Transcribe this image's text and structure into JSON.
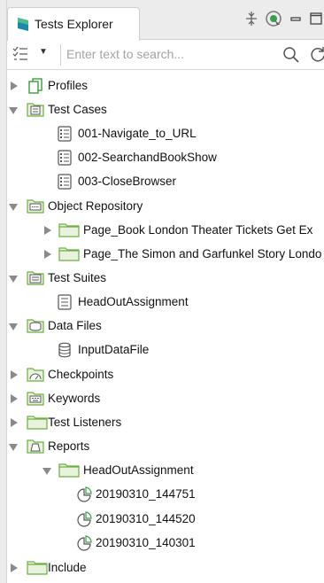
{
  "tab": {
    "title": "Tests Explorer"
  },
  "toolbar": {
    "icons": [
      "collapse-all-icon",
      "focus-icon",
      "minimize-icon",
      "maximize-icon"
    ]
  },
  "search": {
    "placeholder": "Enter text to search...",
    "value": ""
  },
  "tree": {
    "profiles": "Profiles",
    "test_cases": "Test Cases",
    "tc_1": "001-Navigate_to_URL",
    "tc_2": "002-SearchandBookShow",
    "tc_3": "003-CloseBrowser",
    "object_repository": "Object Repository",
    "or_1": "Page_Book London Theater Tickets  Get Ex",
    "or_2": "Page_The Simon and Garfunkel Story Londo",
    "test_suites": "Test Suites",
    "ts_1": "HeadOutAssignment",
    "data_files": "Data Files",
    "df_1": "InputDataFile",
    "checkpoints": "Checkpoints",
    "keywords": "Keywords",
    "test_listeners": "Test Listeners",
    "reports": "Reports",
    "rp_folder": "HeadOutAssignment",
    "rp_1": "20190310_144751",
    "rp_2": "20190310_144520",
    "rp_3": "20190310_140301",
    "include": "Include"
  },
  "colors": {
    "folder_green": "#6fae44",
    "folder_fill": "#e9f2dc",
    "arrow": "#8a8a8a"
  }
}
